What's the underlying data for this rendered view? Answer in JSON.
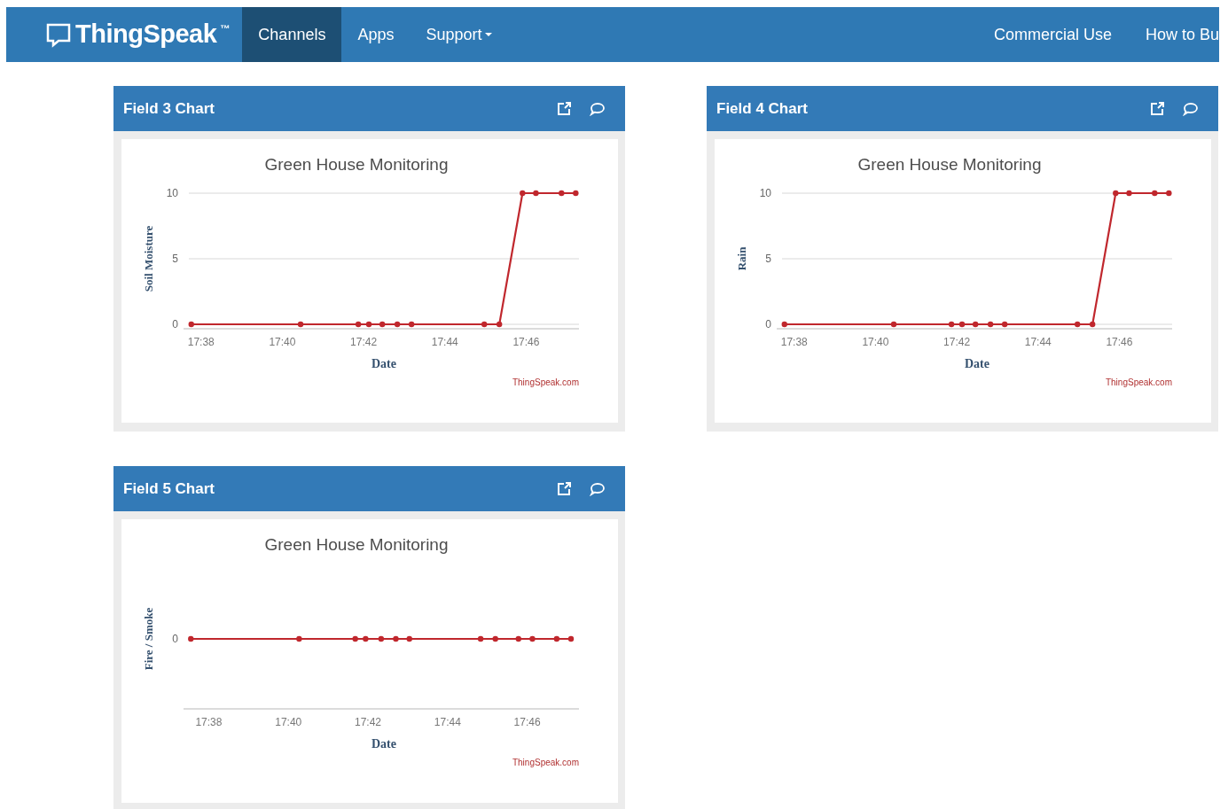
{
  "navbar": {
    "logo": "ThingSpeak",
    "trademark": "™",
    "items": [
      {
        "label": "Channels",
        "selected": true,
        "dropdown": false
      },
      {
        "label": "Apps",
        "selected": false,
        "dropdown": false
      },
      {
        "label": "Support",
        "selected": false,
        "dropdown": true
      }
    ],
    "right_items": [
      "Commercial Use",
      "How to Bu"
    ]
  },
  "panels": [
    {
      "title": "Field 3 Chart",
      "credit": "ThingSpeak.com",
      "chart_data": {
        "type": "line",
        "title": "Green House Monitoring",
        "xlabel": "Date",
        "ylabel": "Soil Moisture",
        "x": [
          1057.76,
          1060.45,
          1061.87,
          1062.13,
          1062.46,
          1062.83,
          1063.18,
          1064.97,
          1065.34,
          1065.91,
          1066.24,
          1066.87,
          1067.22
        ],
        "series": [
          {
            "color": "#c0272d",
            "marker": "circle",
            "values": [
              0,
              0,
              0,
              0,
              0,
              0,
              0,
              0,
              0,
              10,
              10,
              10,
              10
            ]
          }
        ],
        "xlim": [
          1057.7,
          1067.3
        ],
        "ylim": [
          0,
          10
        ],
        "xticks": [
          {
            "value": 1058,
            "label": "17:38"
          },
          {
            "value": 1060,
            "label": "17:40"
          },
          {
            "value": 1062,
            "label": "17:42"
          },
          {
            "value": 1064,
            "label": "17:44"
          },
          {
            "value": 1066,
            "label": "17:46"
          }
        ],
        "yticks": [
          0,
          5,
          10
        ]
      }
    },
    {
      "title": "Field 4 Chart",
      "credit": "ThingSpeak.com",
      "chart_data": {
        "type": "line",
        "title": "Green House Monitoring",
        "xlabel": "Date",
        "ylabel": "Rain",
        "x": [
          1057.76,
          1060.45,
          1061.87,
          1062.13,
          1062.46,
          1062.83,
          1063.18,
          1064.97,
          1065.34,
          1065.91,
          1066.24,
          1066.87,
          1067.22
        ],
        "series": [
          {
            "color": "#c0272d",
            "marker": "circle",
            "values": [
              0,
              0,
              0,
              0,
              0,
              0,
              0,
              0,
              0,
              10,
              10,
              10,
              10
            ]
          }
        ],
        "xlim": [
          1057.7,
          1067.3
        ],
        "ylim": [
          0,
          10
        ],
        "xticks": [
          {
            "value": 1058,
            "label": "17:38"
          },
          {
            "value": 1060,
            "label": "17:40"
          },
          {
            "value": 1062,
            "label": "17:42"
          },
          {
            "value": 1064,
            "label": "17:44"
          },
          {
            "value": 1066,
            "label": "17:46"
          }
        ],
        "yticks": [
          0,
          5,
          10
        ]
      }
    },
    {
      "title": "Field 5 Chart",
      "credit": "ThingSpeak.com",
      "chart": {
        "kind": "flat_line",
        "title": "Green House Monitoring",
        "xlabel": "Date",
        "ylabel": "Fire / Smoke",
        "y_tick_label": "0",
        "x_tick_labels": [
          "17:38",
          "17:40",
          "17:42",
          "17:44",
          "17:46"
        ]
      }
    }
  ]
}
